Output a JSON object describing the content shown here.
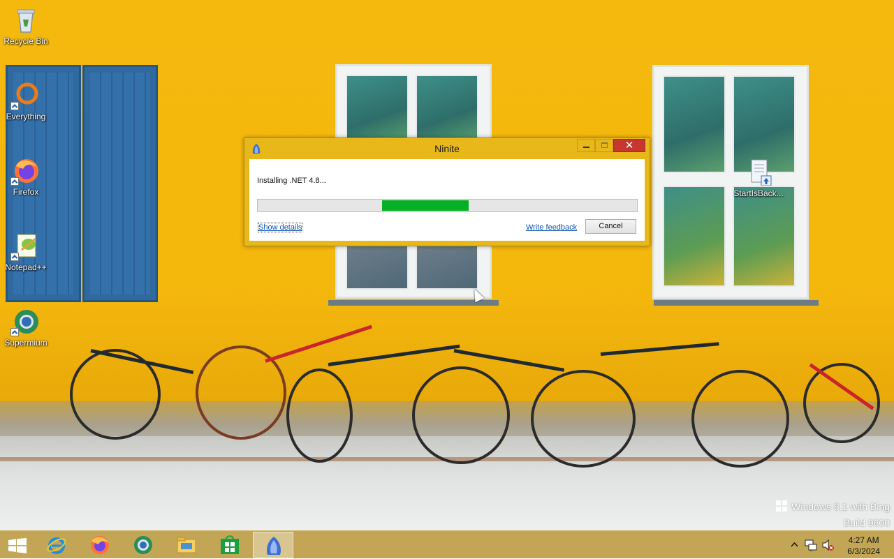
{
  "desktop": {
    "icons": [
      {
        "label": "Recycle Bin"
      },
      {
        "label": "Everything"
      },
      {
        "label": "Firefox"
      },
      {
        "label": "Notepad++"
      },
      {
        "label": "Supermium"
      },
      {
        "label": "StartIsBack..."
      }
    ]
  },
  "dialog": {
    "title": "Ninite",
    "status": "Installing .NET 4.8...",
    "progress_fraction": 0.23,
    "show_details": "Show details",
    "write_feedback": "Write feedback",
    "cancel": "Cancel",
    "close_symbol": "✕"
  },
  "watermark": {
    "line1": "Windows 8.1 with Bing",
    "line2": "Build 9600"
  },
  "taskbar": {
    "items": [
      {
        "icon": "windows-start-icon"
      },
      {
        "icon": "internet-explorer-icon"
      },
      {
        "icon": "firefox-icon"
      },
      {
        "icon": "supermium-icon"
      },
      {
        "icon": "file-explorer-icon"
      },
      {
        "icon": "store-icon"
      },
      {
        "icon": "ninite-icon",
        "active": true
      }
    ],
    "clock_time": "4:27 AM",
    "clock_date": "6/3/2024"
  },
  "colors": {
    "dialog_frame": "#e8b81a",
    "progress_fill": "#06b025",
    "close_button": "#c7372f",
    "taskbar": "#be9e46"
  }
}
